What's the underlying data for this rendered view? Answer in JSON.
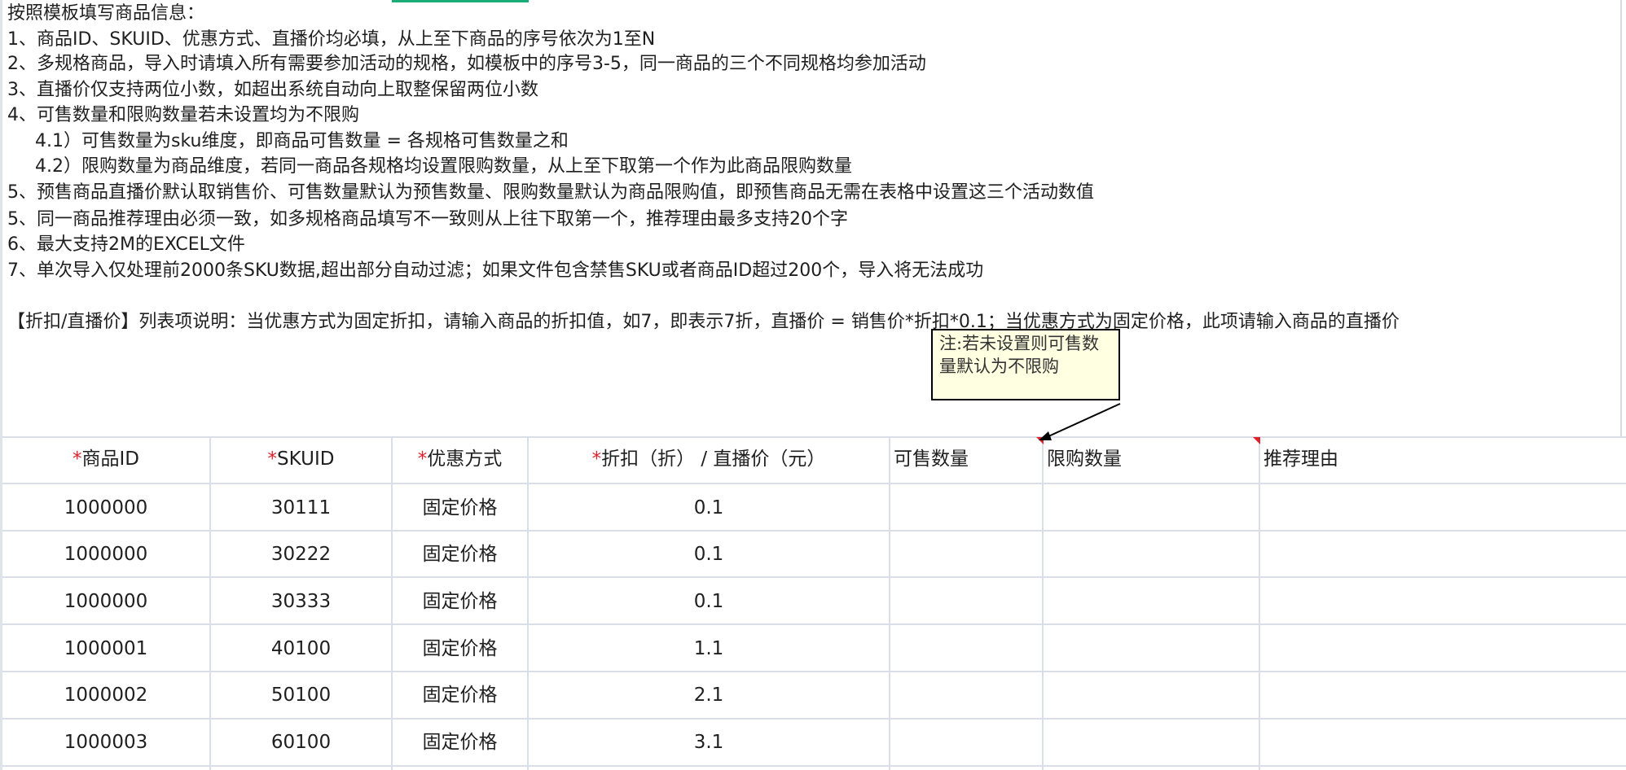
{
  "instructions": {
    "lines": [
      "按照模板填写商品信息：",
      "1、商品ID、SKUID、优惠方式、直播价均必填，从上至下商品的序号依次为1至N",
      "2、多规格商品，导入时请填入所有需要参加活动的规格，如模板中的序号3-5，同一商品的三个不同规格均参加活动",
      "3、直播价仅支持两位小数，如超出系统自动向上取整保留两位小数",
      "4、可售数量和限购数量若未设置均为不限购",
      "4.1）可售数量为sku维度，即商品可售数量 = 各规格可售数量之和",
      "4.2）限购数量为商品维度，若同一商品各规格均设置限购数量，从上至下取第一个作为此商品限购数量",
      "5、预售商品直播价默认取销售价、可售数量默认为预售数量、限购数量默认为商品限购值，即预售商品无需在表格中设置这三个活动数值",
      "5、同一商品推荐理由必须一致，如多规格商品填写不一致则从上往下取第一个，推荐理由最多支持20个字",
      "6、最大支持2M的EXCEL文件",
      "7、单次导入仅处理前2000条SKU数据,超出部分自动过滤；如果文件包含禁售SKU或者商品ID超过200个，导入将无法成功",
      "【折扣/直播价】列表项说明：当优惠方式为固定折扣，请输入商品的折扣值，如7，即表示7折，直播价 = 销售价*折扣*0.1；当优惠方式为固定价格，此项请输入商品的直播价"
    ]
  },
  "comment": {
    "text": "注:若未设置则可售数量默认为不限购"
  },
  "table": {
    "required_mark": "*",
    "headers": [
      "商品ID",
      "SKUID",
      "优惠方式",
      "折扣（折） / 直播价（元）",
      "可售数量",
      "限购数量",
      "推荐理由"
    ],
    "rows": [
      [
        "1000000",
        "30111",
        "固定价格",
        "0.1",
        "",
        "",
        ""
      ],
      [
        "1000000",
        "30222",
        "固定价格",
        "0.1",
        "",
        "",
        ""
      ],
      [
        "1000000",
        "30333",
        "固定价格",
        "0.1",
        "",
        "",
        ""
      ],
      [
        "1000001",
        "40100",
        "固定价格",
        "1.1",
        "",
        "",
        ""
      ],
      [
        "1000002",
        "50100",
        "固定价格",
        "2.1",
        "",
        "",
        ""
      ],
      [
        "1000003",
        "60100",
        "固定价格",
        "3.1",
        "",
        "",
        ""
      ]
    ]
  },
  "colors": {
    "required_mark": "#e0202a",
    "grid_line": "#d9dee8",
    "comment_bg": "#ffffe1",
    "active_tab": "#1aad7a"
  }
}
